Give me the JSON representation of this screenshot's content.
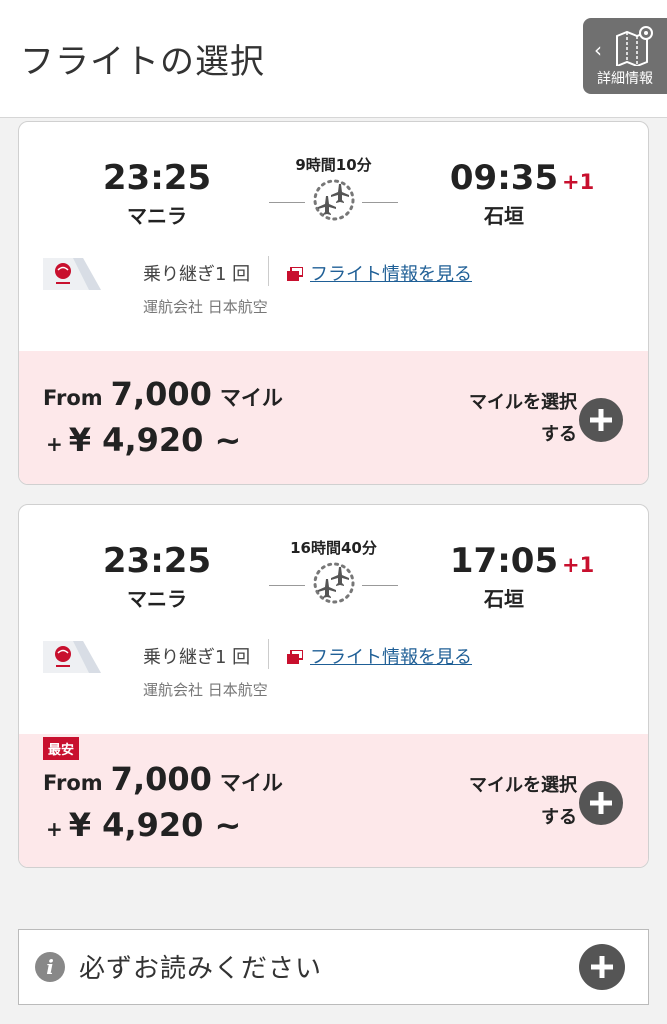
{
  "header": {
    "title": "フライトの選択",
    "detail_label": "詳細情報",
    "detail_icon": "map-pin-icon"
  },
  "colors": {
    "brand_red": "#c8102e",
    "price_bg": "#fde8ea",
    "link_blue": "#1f5f96"
  },
  "flights": [
    {
      "dep_time": "23:25",
      "dep_city": "マニラ",
      "arr_time": "09:35",
      "arr_city": "石垣",
      "day_offset": "+1",
      "duration": "9時間10分",
      "stops": "乗り継ぎ1 回",
      "info_link": "フライト情報を見る",
      "operator": "運航会社 日本航空",
      "badge": "",
      "from_label": "From",
      "miles": "7,000",
      "miles_unit": "マイル",
      "plus": "+",
      "yen": "¥ 4,920 ~",
      "select_line1": "マイルを選択",
      "select_line2": "する"
    },
    {
      "dep_time": "23:25",
      "dep_city": "マニラ",
      "arr_time": "17:05",
      "arr_city": "石垣",
      "day_offset": "+1",
      "duration": "16時間40分",
      "stops": "乗り継ぎ1 回",
      "info_link": "フライト情報を見る",
      "operator": "運航会社 日本航空",
      "badge": "最安",
      "from_label": "From",
      "miles": "7,000",
      "miles_unit": "マイル",
      "plus": "+",
      "yen": "¥ 4,920 ~",
      "select_line1": "マイルを選択",
      "select_line2": "する"
    }
  ],
  "notice": {
    "text": "必ずお読みください",
    "icon": "info-icon"
  }
}
